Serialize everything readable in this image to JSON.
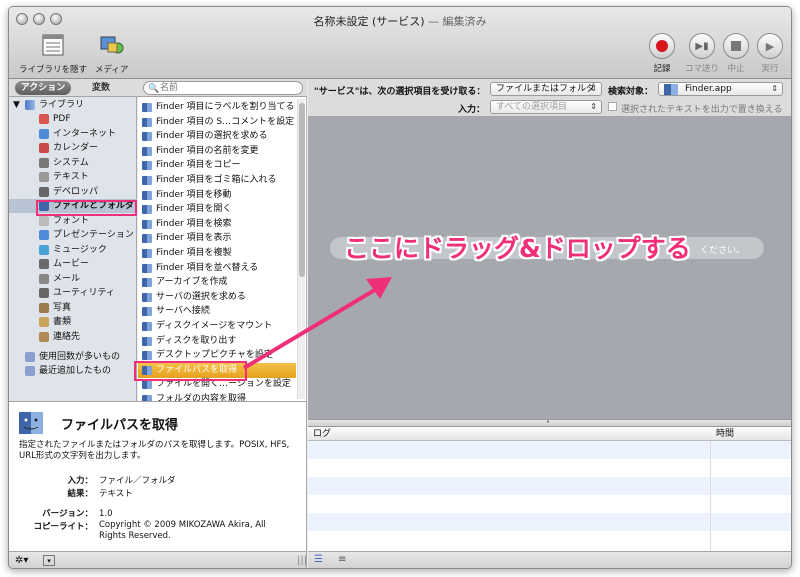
{
  "window": {
    "title": "名称未設定 (サービス)",
    "title_suffix": " — 編集済み"
  },
  "toolbar": {
    "hide_library": "ライブラリを隠す",
    "media": "メディア",
    "record": "記録",
    "step": "コマ送り",
    "stop": "中止",
    "run": "実行"
  },
  "tabs": {
    "actions": "アクション",
    "variables": "変数"
  },
  "search": {
    "placeholder": "名前"
  },
  "library": {
    "root": "ライブラリ",
    "items": [
      "PDF",
      "インターネット",
      "カレンダー",
      "システム",
      "テキスト",
      "デベロッパ",
      "ファイルとフォルダ",
      "フォント",
      "プレゼンテーション",
      "ミュージック",
      "ムービー",
      "メール",
      "ユーティリティ",
      "写真",
      "書類",
      "連絡先"
    ],
    "smart": [
      "使用回数が多いもの",
      "最近追加したもの"
    ]
  },
  "actions": [
    "Finder 項目にラベルを割り当てる",
    "Finder 項目の S…コメントを設定",
    "Finder 項目の選択を求める",
    "Finder 項目の名前を変更",
    "Finder 項目をコピー",
    "Finder 項目をゴミ箱に入れる",
    "Finder 項目を移動",
    "Finder 項目を開く",
    "Finder 項目を検索",
    "Finder 項目を表示",
    "Finder 項目を複製",
    "Finder 項目を並べ替える",
    "アーカイブを作成",
    "サーバの選択を求める",
    "サーバへ接続",
    "ディスクイメージをマウント",
    "ディスクを取り出す",
    "デスクトップピクチャを設定",
    "ファイルパスを取得",
    "ファイルを開く…ーションを設定",
    "フォルダの内容を取得"
  ],
  "description": {
    "title": "ファイルパスを取得",
    "text": "指定されたファイルまたはフォルダのパスを取得します。POSIX, HFS, URL形式の文字列を出力します。",
    "input_label": "入力：",
    "input_value": "ファイル／フォルダ",
    "result_label": "結果：",
    "result_value": "テキスト",
    "version_label": "バージョン：",
    "version_value": "1.0",
    "copyright_label": "コピーライト：",
    "copyright_value": "Copyright © 2009 MIKOZAWA Akira, All Rights Reserved."
  },
  "workflow": {
    "service_prefix": "\"サービス\"は、次の選択項目を受け取る：",
    "receives": "ファイルまたはフォルダ",
    "target_label": "検索対象：",
    "target_app": "Finder.app",
    "input_label": "入力：",
    "input_value": "すべての選択項目",
    "replace_label": "選択されたテキストを出力で置き換える",
    "drop_tail": "ください。",
    "callout": "ここにドラッグ&ドロップする"
  },
  "log": {
    "col_log": "ログ",
    "col_time": "時間"
  },
  "colors": {
    "highlight": "#ef2f7a",
    "selection": "#f0b030"
  }
}
